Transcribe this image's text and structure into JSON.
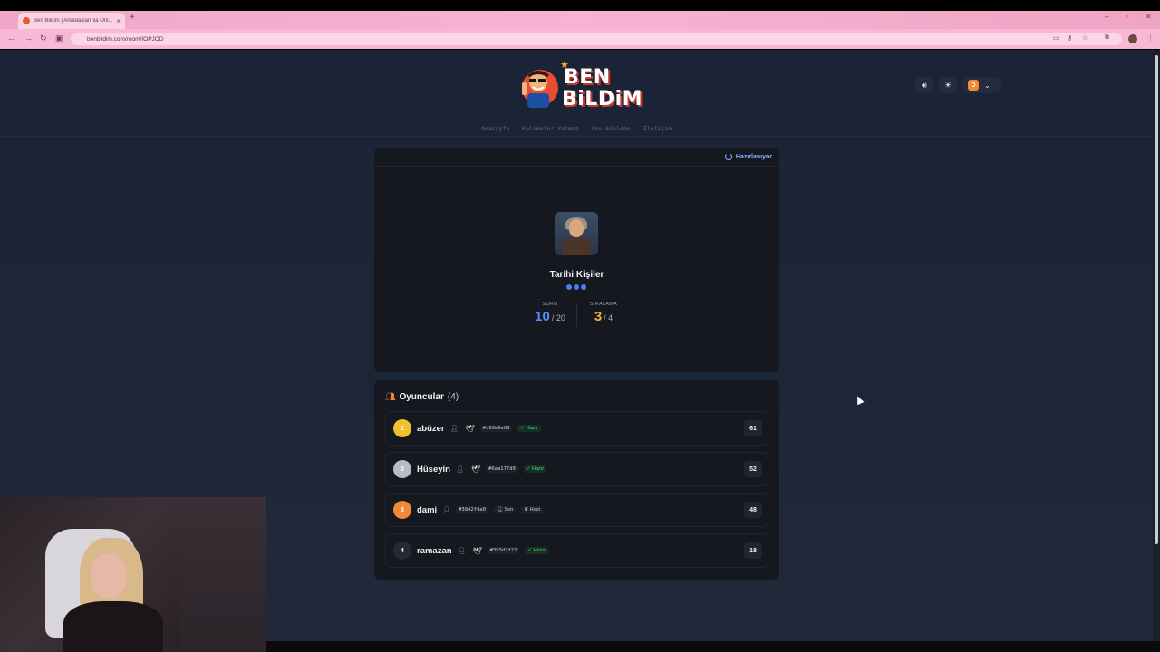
{
  "browser": {
    "tab_title": "Ben Bildim | Arkadaşlarınla Onl...",
    "tab_close": "×",
    "new_tab": "+",
    "url": "benbildim.com/room/IOPJOD"
  },
  "header": {
    "logo_line1": "BEN",
    "logo_line2": "BiLDiM",
    "user_initial": "D"
  },
  "nav": {
    "items": [
      "Anasayfa",
      "Kelimeler Yetmez",
      "Onu Söyleme",
      "İletişim"
    ]
  },
  "game": {
    "status": "Hazırlanıyor",
    "category": "Tarihi Kişiler",
    "question_label": "SORU",
    "question_current": "10",
    "question_total": "/ 20",
    "rank_label": "SIRALAMA",
    "rank_current": "3",
    "rank_total": "/ 4"
  },
  "players": {
    "title": "Oyuncular",
    "count": "(4)",
    "list": [
      {
        "rank": "1",
        "name": "abüzer",
        "id": "#c99e6e08",
        "badge": "Hazır",
        "score": "61",
        "rank_color": "#f2c12e"
      },
      {
        "rank": "2",
        "name": "Hüseyin",
        "id": "#6aa177d9",
        "badge": "Hazır",
        "score": "52",
        "rank_color": "#b8bcc4"
      },
      {
        "rank": "3",
        "name": "dami",
        "id": "#3842f4a0",
        "badge_me": "Sen",
        "badge_host": "Host",
        "score": "48",
        "rank_color": "#f08a3a"
      },
      {
        "rank": "4",
        "name": "ramazan",
        "id": "#393d7f22",
        "badge": "Hazır",
        "score": "18",
        "rank_color": "#232a33"
      }
    ]
  },
  "colors": {
    "question_accent": "#4d8ef7",
    "rank_accent": "#f2b230",
    "ready_green": "#52d07c"
  }
}
